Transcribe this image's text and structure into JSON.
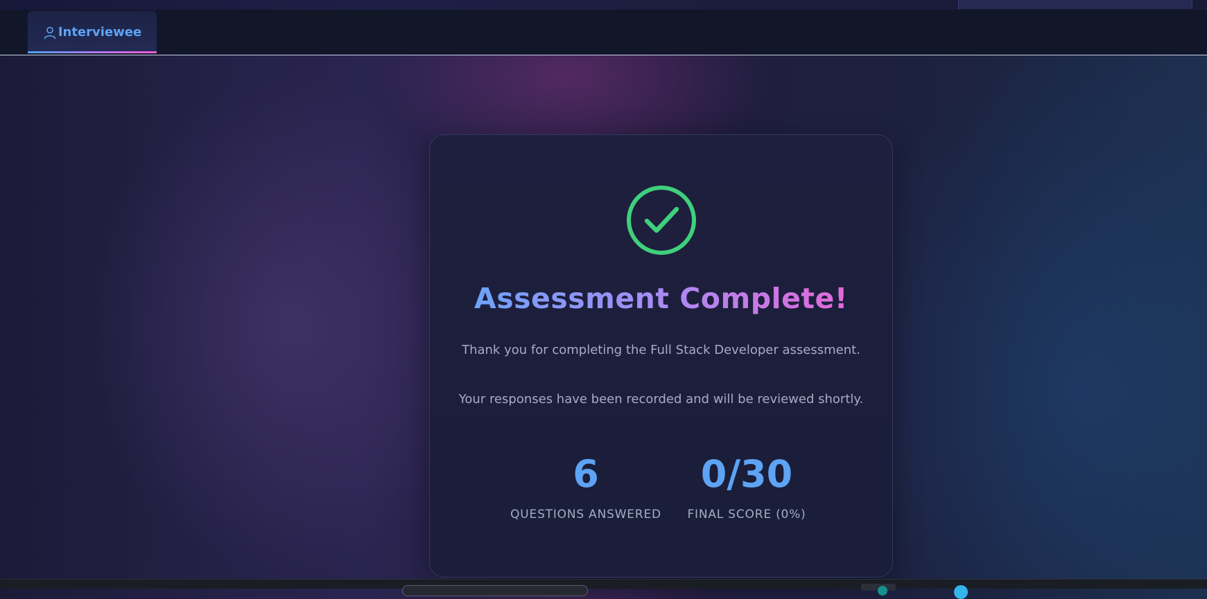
{
  "tabs": [
    {
      "label": "Interviewee",
      "icon": "user-icon",
      "active": true
    }
  ],
  "result": {
    "title": "Assessment Complete!",
    "icon": "check-circle-icon",
    "message_line1": "Thank you for completing the Full Stack Developer assessment.",
    "message_line2": "Your responses have been recorded and will be reviewed shortly.",
    "stats": [
      {
        "value": "6",
        "label": "QUESTIONS ANSWERED"
      },
      {
        "value": "0/30",
        "label": "FINAL SCORE (0%)"
      }
    ]
  },
  "colors": {
    "accent": "#5ea3f4",
    "success": "#3fd07c",
    "gradient_start": "#5fa8f7",
    "gradient_end": "#f060d3",
    "muted_text": "#a5adc4"
  }
}
